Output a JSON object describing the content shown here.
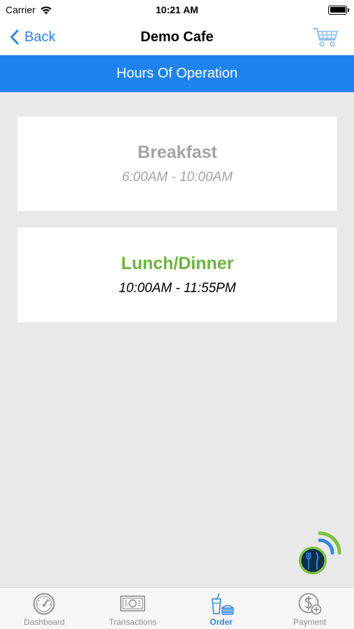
{
  "status_bar": {
    "carrier": "Carrier",
    "time": "10:21 AM"
  },
  "nav": {
    "back_label": "Back",
    "title": "Demo Cafe",
    "cart_icon": "shopping-cart-icon"
  },
  "section": {
    "title": "Hours Of Operation"
  },
  "meals": [
    {
      "name": "Breakfast",
      "hours": "6:00AM - 10:00AM",
      "available": false
    },
    {
      "name": "Lunch/Dinner",
      "hours": "10:00AM - 11:55PM",
      "available": true
    }
  ],
  "fab": {
    "icon": "fork-knife-icon"
  },
  "tabs": [
    {
      "label": "Dashboard",
      "icon": "speedometer-icon",
      "active": false
    },
    {
      "label": "Transactions",
      "icon": "cash-icon",
      "active": false
    },
    {
      "label": "Order",
      "icon": "drink-burger-icon",
      "active": true
    },
    {
      "label": "Payment",
      "icon": "dollar-add-icon",
      "active": false
    }
  ],
  "colors": {
    "accent_blue": "#1e83f0",
    "link_blue": "#2f86e6",
    "available_green": "#6cb33f",
    "unavailable_gray": "#a3a3a3",
    "background": "#e9e9e9"
  }
}
